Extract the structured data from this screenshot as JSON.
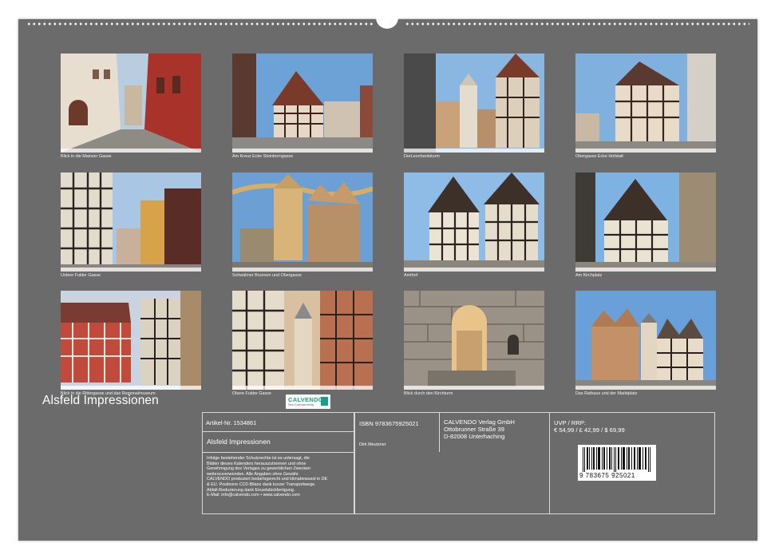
{
  "photos": [
    {
      "caption": "Blick in die Mainzer Gasse"
    },
    {
      "caption": "Am Kreuz Ecke Steinborngasse"
    },
    {
      "caption": "DerLeonhardsturm"
    },
    {
      "caption": "Obergasse Ecke Hofstatt"
    },
    {
      "caption": "Untere Fulder Gasse"
    },
    {
      "caption": "Schwälmer Brunnen und Obergasse"
    },
    {
      "caption": "Amthof"
    },
    {
      "caption": "Am Kirchplatz"
    },
    {
      "caption": "Blick in die Rittergasse und das Regionalmuseum"
    },
    {
      "caption": "Obere Fulder Gasse"
    },
    {
      "caption": "Blick durch den Kirchturm"
    },
    {
      "caption": "Das Rathaus und der Marktplatz"
    }
  ],
  "calendar_title": "Alsfeld Impressionen",
  "info": {
    "article_number": "Artikel-Nr. 1534861",
    "product_title": "Alsfeld Impressionen",
    "legal_lines": [
      "Infolge bestehender Schutzrechte ist es untersagt, die",
      "Blätter dieses Kalenders herauszutrennen und ohne",
      "Genehmigung des Verlages zu gewerblichen Zwecken",
      "weiterzuverwenden. Alle Angaben ohne Gewähr.",
      " CALVENDO produziert bedarfsgerecht und klimabewusst in DE",
      "& EU. Positivere CO2-Bilanz dank kurzer Transportwege.",
      "Abfall-Reduzierung dank Einzelstückfertigung.",
      " E-Mail: info@calvendo.com • www.calvendo.com"
    ],
    "isbn": "ISBN 9783675925021",
    "author": "Dirk Meutzner",
    "publisher_lines": [
      "CALVENDO Verlag GmbH",
      "Ottobrunner Straße 39",
      "D-82008 Unterhaching"
    ],
    "price_label": "UVP / RRP:",
    "price_values": "€ 54,99 / £ 42,99 / $ 69,99",
    "logo_text": "CALVENDO",
    "logo_sub": "Mein Kalenderverlag",
    "barcode_digits": "9 783675 925021"
  }
}
